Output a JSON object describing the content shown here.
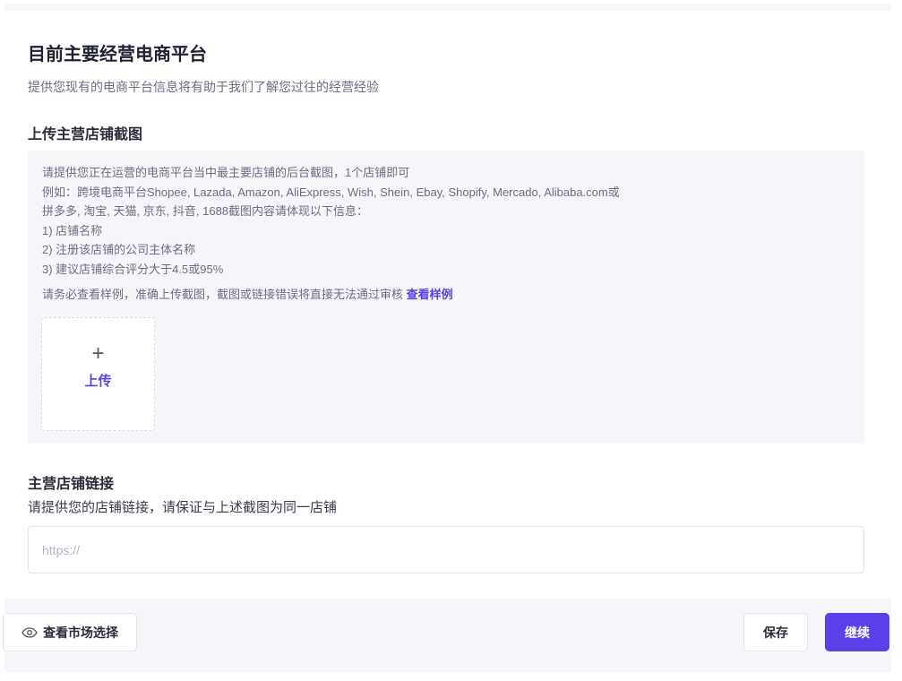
{
  "header": {
    "title": "目前主要经营电商平台",
    "subtitle": "提供您现有的电商平台信息将有助于我们了解您过往的经营经验"
  },
  "screenshot": {
    "title": "上传主营店铺截图",
    "lines": [
      "请提供您正在运营的电商平台当中最主要店铺的后台截图，1个店铺即可",
      "例如：跨境电商平台Shopee, Lazada, Amazon, AliExpress, Wish, Shein, Ebay, Shopify, Mercado, Alibaba.com或",
      "拼多多, 淘宝, 天猫, 京东, 抖音, 1688截图内容请体现以下信息：",
      "1) 店铺名称",
      "2) 注册该店铺的公司主体名称",
      "3) 建议店铺综合评分大于4.5或95%"
    ],
    "note": "请务必查看样例，准确上传截图，截图或链接错误将直接无法通过审核 ",
    "example_link": "查看样例",
    "upload_plus": "+",
    "upload_label": "上传"
  },
  "link": {
    "title": "主营店铺链接",
    "subtitle": "请提供您的店铺链接，请保证与上述截图为同一店铺",
    "placeholder": "https://",
    "value": ""
  },
  "footer": {
    "market_label": "查看市场选择",
    "save_label": "保存",
    "continue_label": "继续"
  },
  "colors": {
    "accent": "#5b3fe8"
  }
}
